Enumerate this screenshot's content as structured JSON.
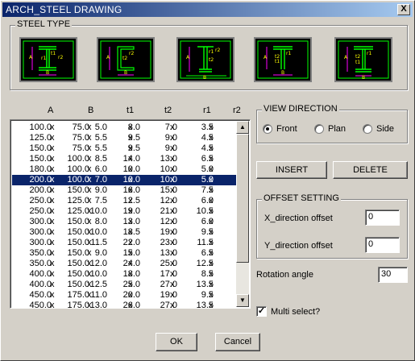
{
  "window": {
    "title": "ARCH_STEEL DRAWING",
    "close_label": "X"
  },
  "steel_type": {
    "label": "STEEL TYPE",
    "thumbnails": [
      {
        "name": "h-beam-profile"
      },
      {
        "name": "channel-profile"
      },
      {
        "name": "i-beam-profile"
      },
      {
        "name": "t-bar-profile"
      },
      {
        "name": "angle-profile"
      }
    ]
  },
  "columns": [
    "A",
    "B",
    "t1",
    "t2",
    "r1",
    "r2"
  ],
  "rows": [
    [
      "100.0",
      "x",
      "75.0",
      "x",
      "5.0",
      "x",
      "8.0",
      "x",
      "7.0",
      "x",
      "3.5"
    ],
    [
      "125.0",
      "x",
      "75.0",
      "x",
      "5.5",
      "x",
      "9.5",
      "x",
      "9.0",
      "x",
      "4.5"
    ],
    [
      "150.0",
      "x",
      "75.0",
      "x",
      "5.5",
      "x",
      "9.5",
      "x",
      "9.0",
      "x",
      "4.5"
    ],
    [
      "150.0",
      "x",
      "100.0",
      "x",
      "8.5",
      "x",
      "14.0",
      "x",
      "13.0",
      "x",
      "6.5"
    ],
    [
      "180.0",
      "x",
      "100.0",
      "x",
      "6.0",
      "x",
      "10.0",
      "x",
      "10.0",
      "x",
      "5.0"
    ],
    [
      "200.0",
      "x",
      "100.0",
      "x",
      "7.0",
      "x",
      "10.0",
      "x",
      "10.0",
      "x",
      "5.0"
    ],
    [
      "200.0",
      "x",
      "150.0",
      "x",
      "9.0",
      "x",
      "16.0",
      "x",
      "15.0",
      "x",
      "7.5"
    ],
    [
      "250.0",
      "x",
      "125.0",
      "x",
      "7.5",
      "x",
      "12.5",
      "x",
      "12.0",
      "x",
      "6.0"
    ],
    [
      "250.0",
      "x",
      "125.0",
      "x",
      "10.0",
      "x",
      "19.0",
      "x",
      "21.0",
      "x",
      "10.5"
    ],
    [
      "300.0",
      "x",
      "150.0",
      "x",
      "8.0",
      "x",
      "13.0",
      "x",
      "12.0",
      "x",
      "6.0"
    ],
    [
      "300.0",
      "x",
      "150.0",
      "x",
      "10.0",
      "x",
      "18.5",
      "x",
      "19.0",
      "x",
      "9.5"
    ],
    [
      "300.0",
      "x",
      "150.0",
      "x",
      "11.5",
      "x",
      "22.0",
      "x",
      "23.0",
      "x",
      "11.5"
    ],
    [
      "350.0",
      "x",
      "150.0",
      "x",
      "9.0",
      "x",
      "15.0",
      "x",
      "13.0",
      "x",
      "6.5"
    ],
    [
      "350.0",
      "x",
      "150.0",
      "x",
      "12.0",
      "x",
      "24.0",
      "x",
      "25.0",
      "x",
      "12.5"
    ],
    [
      "400.0",
      "x",
      "150.0",
      "x",
      "10.0",
      "x",
      "18.0",
      "x",
      "17.0",
      "x",
      "8.5"
    ],
    [
      "400.0",
      "x",
      "150.0",
      "x",
      "12.5",
      "x",
      "25.0",
      "x",
      "27.0",
      "x",
      "13.5"
    ],
    [
      "450.0",
      "x",
      "175.0",
      "x",
      "11.0",
      "x",
      "20.0",
      "x",
      "19.0",
      "x",
      "9.5"
    ],
    [
      "450.0",
      "x",
      "175.0",
      "x",
      "13.0",
      "x",
      "26.0",
      "x",
      "27.0",
      "x",
      "13.5"
    ]
  ],
  "selected_row": 5,
  "view_direction": {
    "label": "VIEW DIRECTION",
    "options": [
      "Front",
      "Plan",
      "Side"
    ],
    "selected": "Front"
  },
  "buttons": {
    "insert": "INSERT",
    "delete": "DELETE",
    "ok": "OK",
    "cancel": "Cancel"
  },
  "offset": {
    "label": "OFFSET SETTING",
    "x_label": "X_direction offset",
    "x_value": "0",
    "y_label": "Y_direction offset",
    "y_value": "0"
  },
  "rotation": {
    "label": "Rotation angle",
    "value": "30"
  },
  "multi_select": {
    "label": "Multi select?",
    "checked": true
  },
  "colors": {
    "profile_line": "#00ff00",
    "dimension": "#ff00ff",
    "label_text": "#ffff00",
    "selection": "#0a246a"
  }
}
